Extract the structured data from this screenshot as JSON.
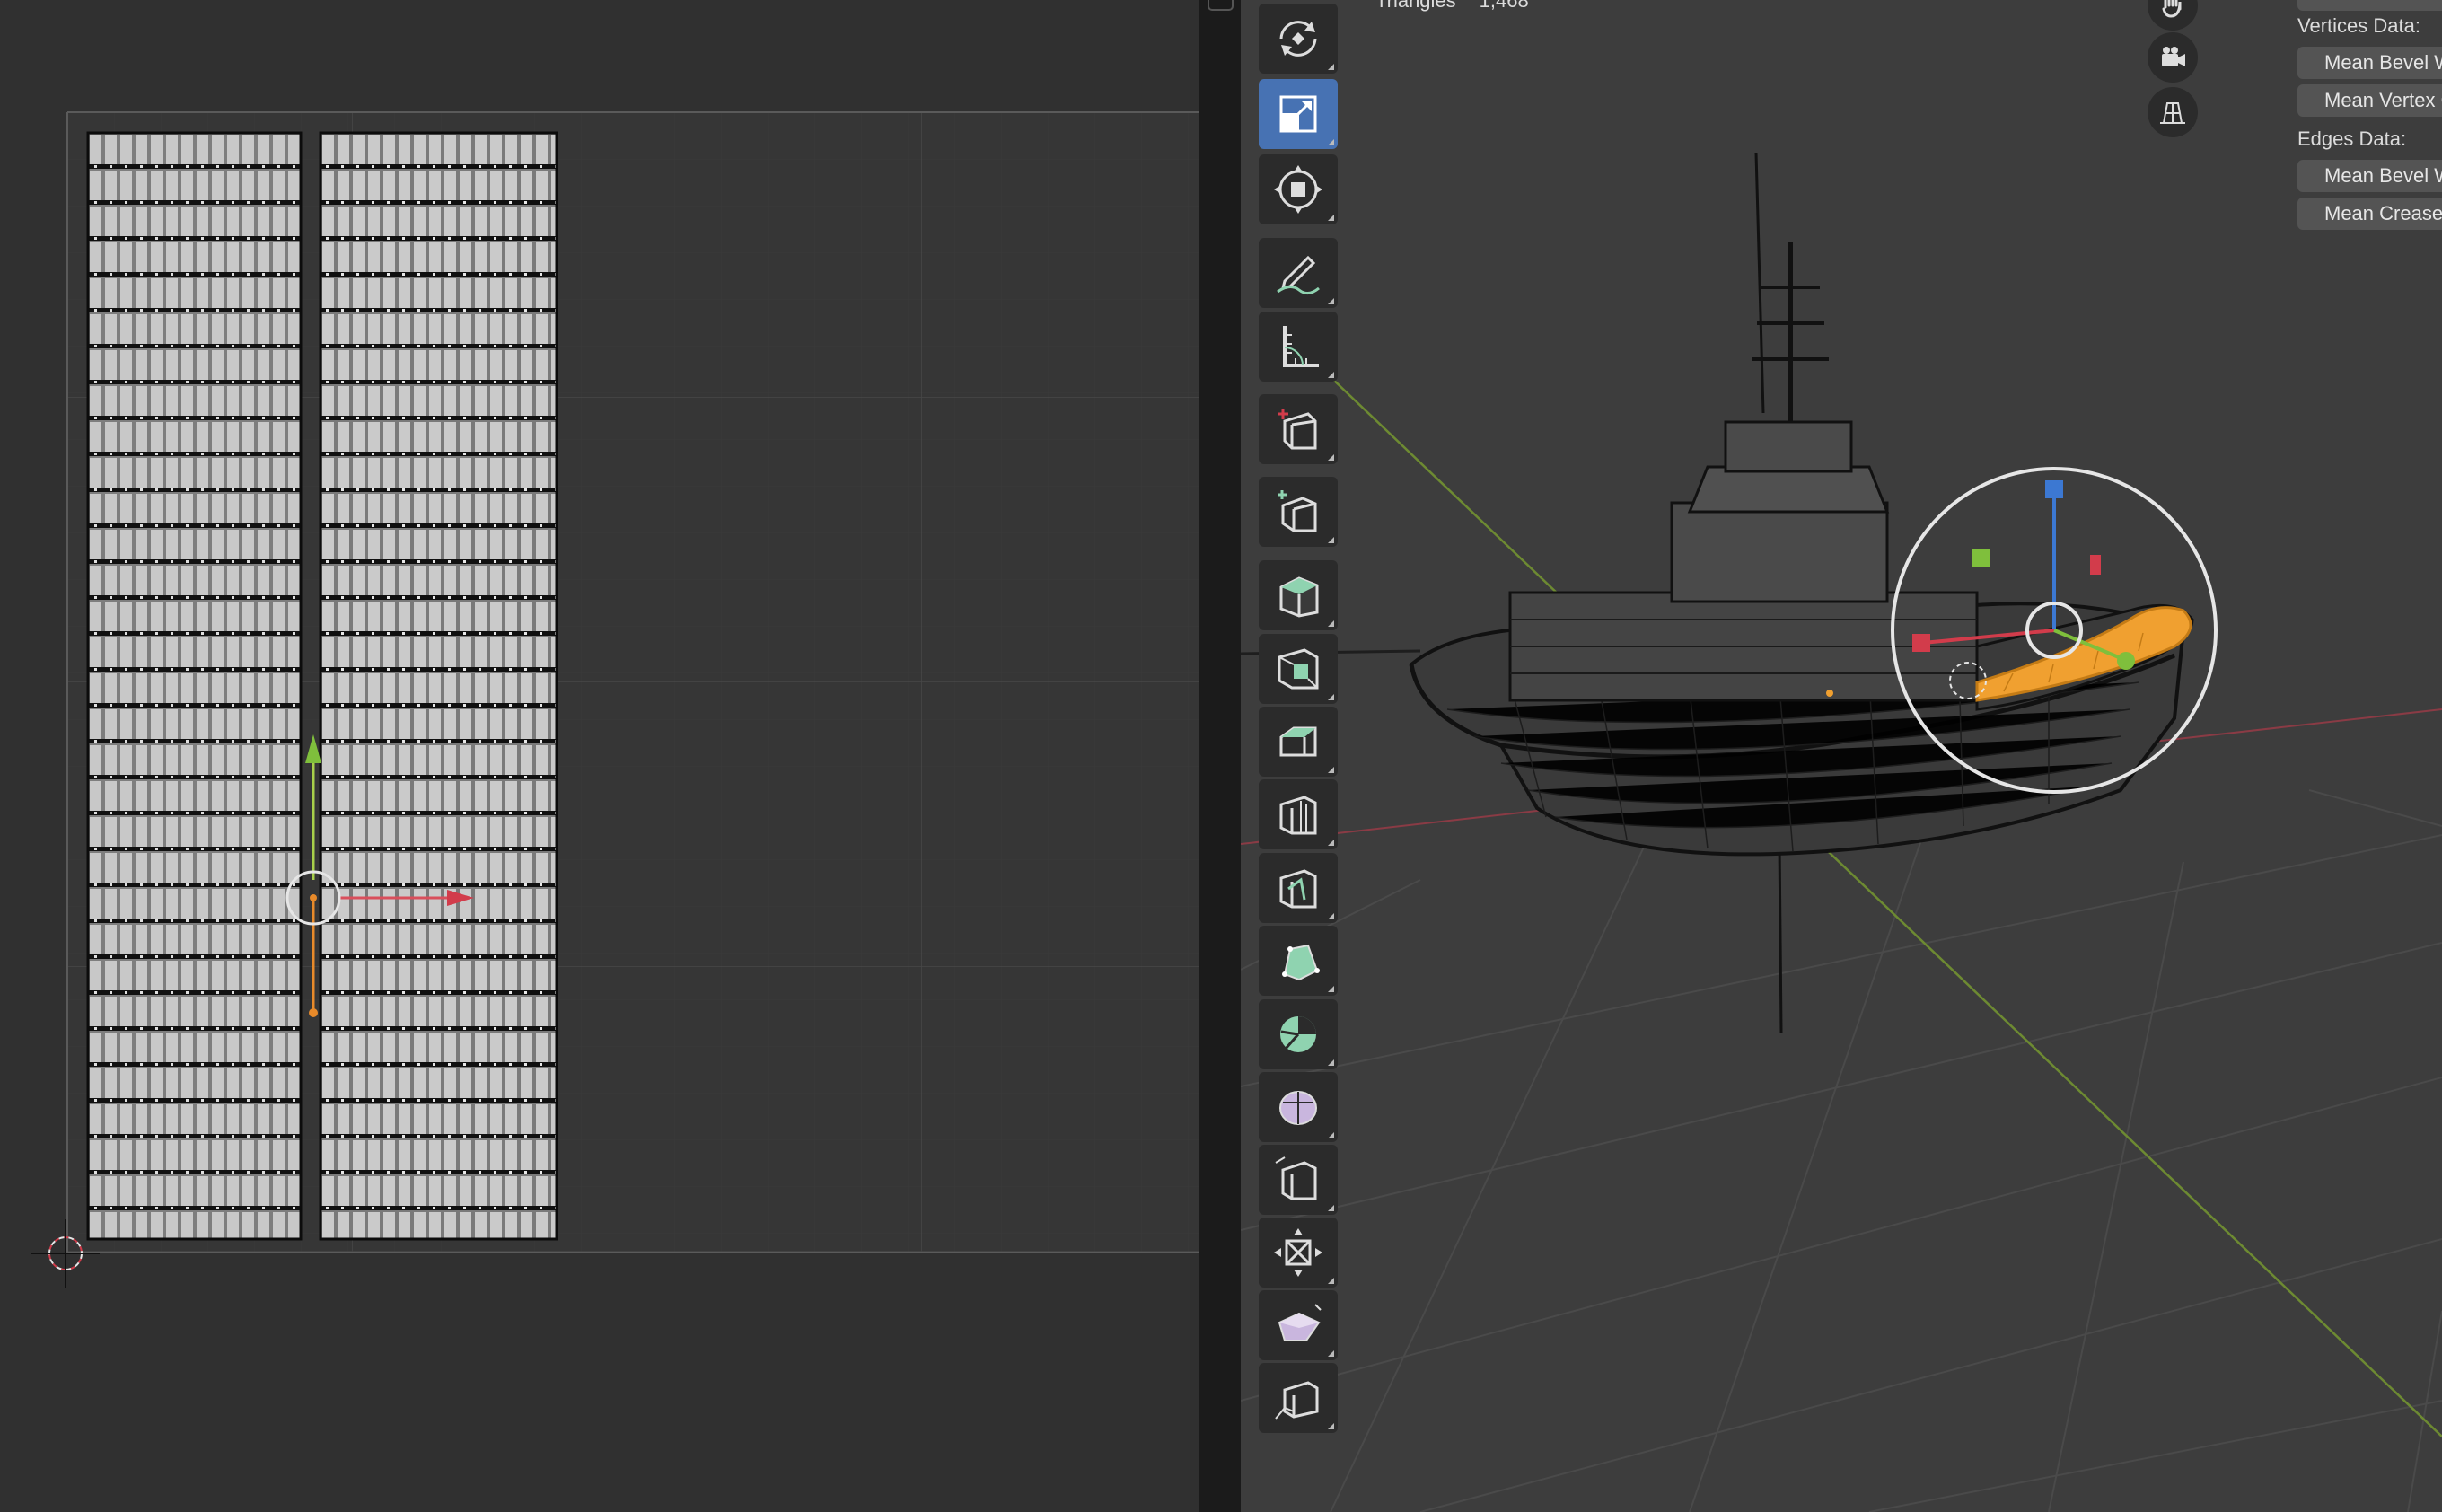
{
  "viewport": {
    "stats": {
      "triangles_label": "Triangles",
      "triangles_value": "1,468"
    }
  },
  "toolbar": {
    "tools": [
      {
        "name": "rotate-tool",
        "icon": "rotate-icon",
        "active": false
      },
      {
        "name": "scale-tool",
        "icon": "scale-icon",
        "active": true
      },
      {
        "name": "transform-tool",
        "icon": "transform-icon",
        "active": false
      },
      {
        "name": "annotate-tool",
        "icon": "annotate-icon",
        "active": false
      },
      {
        "name": "measure-tool",
        "icon": "measure-icon",
        "active": false
      },
      {
        "name": "add-cube-tool",
        "icon": "add-cube-icon",
        "active": false
      },
      {
        "name": "extrude-tool",
        "icon": "extrude-icon",
        "active": false
      },
      {
        "name": "inset-tool",
        "icon": "inset-icon",
        "active": false
      },
      {
        "name": "bevel-tool",
        "icon": "bevel-icon",
        "active": false
      },
      {
        "name": "loop-cut-tool",
        "icon": "loop-cut-icon",
        "active": false
      },
      {
        "name": "knife-tool",
        "icon": "knife-icon",
        "active": false
      },
      {
        "name": "poly-build-tool",
        "icon": "poly-build-icon",
        "active": false
      },
      {
        "name": "spin-tool",
        "icon": "spin-icon",
        "active": false
      },
      {
        "name": "smooth-tool",
        "icon": "smooth-icon",
        "active": false
      },
      {
        "name": "edge-slide-tool",
        "icon": "edge-slide-icon",
        "active": false
      },
      {
        "name": "shrink-fatten-tool",
        "icon": "shrink-fatten-icon",
        "active": false
      },
      {
        "name": "shear-tool",
        "icon": "shear-icon",
        "active": false
      },
      {
        "name": "rip-region-tool",
        "icon": "rip-region-icon",
        "active": false
      }
    ]
  },
  "nav_icons": [
    "hand-icon",
    "camera-icon",
    "grid-view-icon"
  ],
  "side_panel": {
    "vertices_label": "Vertices Data:",
    "mean_bevel_weight_v": "Mean Bevel Weight",
    "mean_vertex_crease": "Mean Vertex Crease",
    "edges_label": "Edges Data:",
    "mean_bevel_weight_e": "Mean Bevel Weight",
    "mean_crease": "Mean Crease"
  },
  "colors": {
    "x_axis": "#d23c4b",
    "y_axis": "#7fbf3c",
    "z_axis": "#3c78d2",
    "active_tool": "#4772b3",
    "selection": "#f0a030"
  }
}
